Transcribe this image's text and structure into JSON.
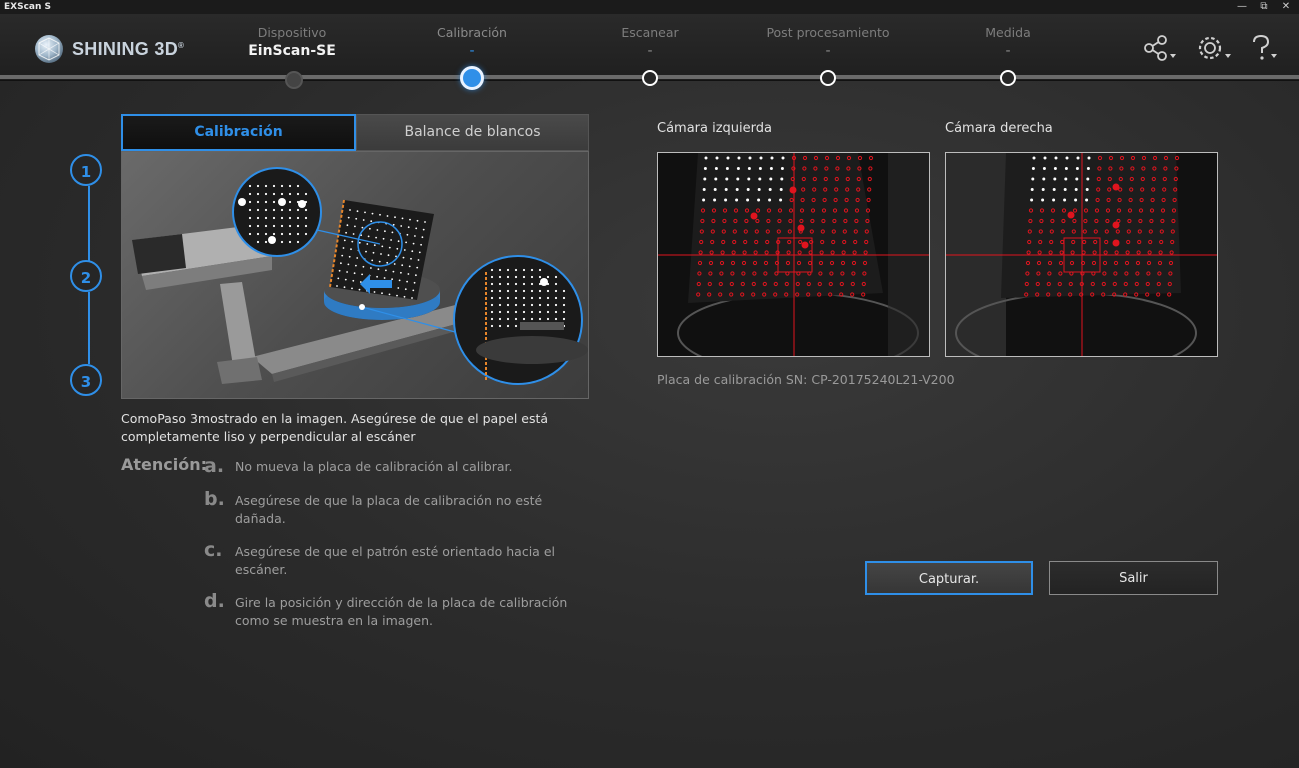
{
  "window": {
    "title": "EXScan S",
    "controls": [
      "minimize-icon",
      "restore-icon",
      "close-icon"
    ]
  },
  "brand": {
    "logo_text": "SHINING 3D",
    "registered": "®"
  },
  "steps": [
    {
      "label": "Dispositivo",
      "value": "EinScan-SE",
      "state": "done"
    },
    {
      "label": "Calibración",
      "value": "-",
      "state": "active"
    },
    {
      "label": "Escanear",
      "value": "-",
      "state": "pending"
    },
    {
      "label": "Post procesamiento",
      "value": "-",
      "state": "pending"
    },
    {
      "label": "Medida",
      "value": "-",
      "state": "pending"
    }
  ],
  "header_icons": [
    "share-icon",
    "settings-icon",
    "help-icon"
  ],
  "tabs": {
    "active": "Calibración",
    "inactive": "Balance de blancos"
  },
  "step_numbers": [
    "1",
    "2",
    "3"
  ],
  "instructions": {
    "description": "ComoPaso 3mostrado en la imagen. Asegúrese de que el papel está completamente liso y perpendicular al escáner",
    "attention_label": "Atención:",
    "items": [
      {
        "letter": "a.",
        "text": "No mueva la placa de calibración al calibrar."
      },
      {
        "letter": "b.",
        "text": "Asegúrese de que la placa de calibración no esté dañada."
      },
      {
        "letter": "c.",
        "text": "Asegúrese de que el patrón esté orientado hacia el escáner."
      },
      {
        "letter": "d.",
        "text": "Gire la posición y dirección de la placa de calibración como se muestra en la imagen."
      }
    ]
  },
  "cameras": {
    "left_title": "Cámara izquierda",
    "right_title": "Cámara derecha"
  },
  "serial": "Placa de calibración SN: CP-20175240L21-V200",
  "buttons": {
    "capture": "Capturar.",
    "exit": "Salir"
  },
  "colors": {
    "accent": "#2f8fe8",
    "crosshair": "#e0141e",
    "background": "#2b2b2b"
  }
}
